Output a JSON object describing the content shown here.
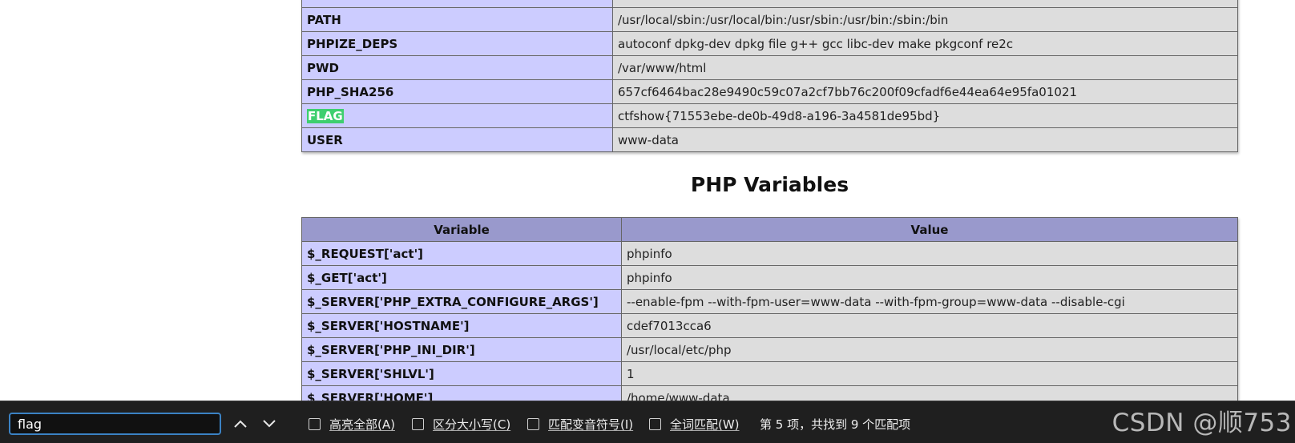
{
  "env_table": {
    "rows": [
      {
        "name": "PATH",
        "value": "/usr/local/sbin:/usr/local/bin:/usr/sbin:/usr/bin:/sbin:/bin"
      },
      {
        "name": "PHPIZE_DEPS",
        "value": "autoconf dpkg-dev dpkg file g++ gcc libc-dev make pkgconf re2c"
      },
      {
        "name": "PWD",
        "value": "/var/www/html"
      },
      {
        "name": "PHP_SHA256",
        "value": "657cf6464bac28e9490c59c07a2cf7bb76c200f09cfadf6e44ea64e95fa01021"
      },
      {
        "name": "FLAG",
        "value": "ctfshow{71553ebe-de0b-49d8-a196-3a4581de95bd}"
      },
      {
        "name": "USER",
        "value": "www-data"
      }
    ]
  },
  "php_variables": {
    "title": "PHP Variables",
    "headers": [
      "Variable",
      "Value"
    ],
    "rows": [
      {
        "name": "$_REQUEST['act']",
        "value": "phpinfo"
      },
      {
        "name": "$_GET['act']",
        "value": "phpinfo"
      },
      {
        "name": "$_SERVER['PHP_EXTRA_CONFIGURE_ARGS']",
        "value": "--enable-fpm --with-fpm-user=www-data --with-fpm-group=www-data --disable-cgi"
      },
      {
        "name": "$_SERVER['HOSTNAME']",
        "value": "cdef7013cca6"
      },
      {
        "name": "$_SERVER['PHP_INI_DIR']",
        "value": "/usr/local/etc/php"
      },
      {
        "name": "$_SERVER['SHLVL']",
        "value": "1"
      },
      {
        "name": "$_SERVER['HOME']",
        "value": "/home/www-data"
      }
    ]
  },
  "find_bar": {
    "query": "flag",
    "prev_icon": "chevron-up-icon",
    "next_icon": "chevron-down-icon",
    "options": [
      {
        "label": "高亮全部(A)",
        "checked": false
      },
      {
        "label": "区分大小写(C)",
        "checked": false
      },
      {
        "label": "匹配变音符号(I)",
        "checked": false
      },
      {
        "label": "全词匹配(W)",
        "checked": false
      }
    ],
    "status": "第 5 项，共找到 9 个匹配项",
    "highlight_color": "#3ecf6f"
  },
  "watermark": "CSDN @顺753"
}
